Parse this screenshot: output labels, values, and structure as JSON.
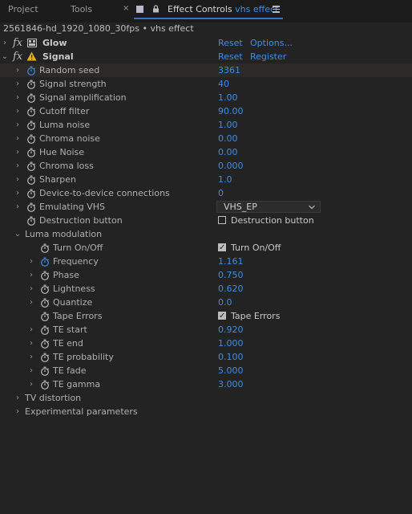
{
  "tabs": {
    "project": "Project",
    "tools": "Tools",
    "close": "×",
    "effect_controls": "Effect Controls",
    "effect_name": "vhs effect"
  },
  "clip_header": "2561846-hd_1920_1080_30fps • vhs effect",
  "effects": {
    "glow": {
      "name": "Glow",
      "reset": "Reset",
      "options": "Options..."
    },
    "signal": {
      "name": "Signal",
      "reset": "Reset",
      "register": "Register"
    }
  },
  "params": {
    "random_seed": {
      "label": "Random seed",
      "value": "3361"
    },
    "signal_strength": {
      "label": "Signal strength",
      "value": "40"
    },
    "signal_amplification": {
      "label": "Signal amplification",
      "value": "1.00"
    },
    "cutoff_filter": {
      "label": "Cutoff filter",
      "value": "90.00"
    },
    "luma_noise": {
      "label": "Luma noise",
      "value": "1.00"
    },
    "chroma_noise": {
      "label": "Chroma noise",
      "value": "0.00"
    },
    "hue_noise": {
      "label": "Hue Noise",
      "value": "0.00"
    },
    "chroma_loss": {
      "label": "Chroma loss",
      "value": "0.000"
    },
    "sharpen": {
      "label": "Sharpen",
      "value": "1.0"
    },
    "device_connections": {
      "label": "Device-to-device connections",
      "value": "0"
    },
    "emulating_vhs": {
      "label": "Emulating VHS",
      "value": "VHS_EP"
    },
    "destruction_button": {
      "label": "Destruction button",
      "checkbox_label": "Destruction button",
      "checked": false
    }
  },
  "luma_modulation": {
    "label": "Luma modulation",
    "turn_on_off": {
      "label": "Turn On/Off",
      "checkbox_label": "Turn On/Off",
      "checked": true
    },
    "frequency": {
      "label": "Frequency",
      "value": "1.161"
    },
    "phase": {
      "label": "Phase",
      "value": "0.750"
    },
    "lightness": {
      "label": "Lightness",
      "value": "0.620"
    },
    "quantize": {
      "label": "Quantize",
      "value": "0.0"
    },
    "tape_errors": {
      "label": "Tape Errors",
      "checkbox_label": "Tape Errors",
      "checked": true
    },
    "te_start": {
      "label": "TE start",
      "value": "0.920"
    },
    "te_end": {
      "label": "TE end",
      "value": "1.000"
    },
    "te_probability": {
      "label": "TE probability",
      "value": "0.100"
    },
    "te_fade": {
      "label": "TE fade",
      "value": "5.000"
    },
    "te_gamma": {
      "label": "TE gamma",
      "value": "3.000"
    }
  },
  "groups": {
    "tv_distortion": "TV distortion",
    "experimental": "Experimental parameters"
  },
  "colors": {
    "accent": "#3d8ee9",
    "background": "#232323",
    "tab_underline": "#3a72c8"
  }
}
